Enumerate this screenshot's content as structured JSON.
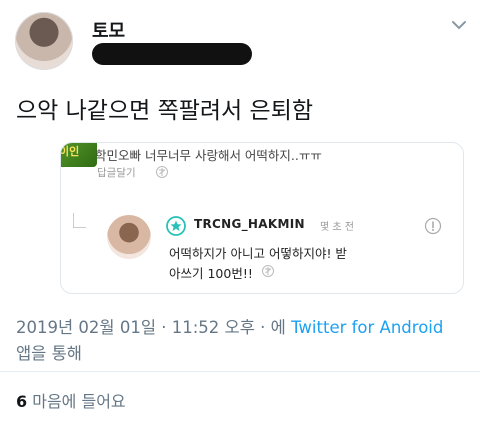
{
  "tweet": {
    "author_name": "토모",
    "text": "으악 나같으면 쪽팔려서 은퇴함",
    "timestamp": "2019년 02월 01일 · 11:52 오후 · 에",
    "source": "Twitter for Android",
    "source_suffix": "앱을 통해",
    "likes_count": "6",
    "likes_label": "마음에 들어요"
  },
  "embedded": {
    "thumb_text": "이인",
    "comment": "학민오빠 너무너무 사랑해서 어떡하지..ㅠㅠ",
    "reply_action": "답글달기",
    "reply_name": "TRCNG_HAKMIN",
    "reply_time": "몇 초 전",
    "reply_line1": "어떡하지가 아니고 어떻하지야! 받",
    "reply_line2": "아쓰기 100번!!"
  },
  "colors": {
    "link": "#1da1f2",
    "meta": "#657786",
    "text": "#14171a",
    "badge": "#27c2b8"
  },
  "icons": [
    "chevron-down-icon",
    "translate-icon",
    "verified-badge-icon",
    "info-icon"
  ]
}
